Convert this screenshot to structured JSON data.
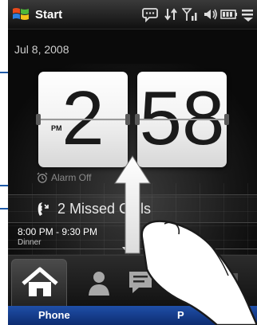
{
  "titlebar": {
    "title": "Start",
    "icons": [
      "windows-flag-icon",
      "chat-bubble-icon",
      "sync-arrows-icon",
      "signal-icon",
      "speaker-icon",
      "battery-icon",
      "menu-icon"
    ]
  },
  "home": {
    "date": "Jul 8, 2008",
    "clock": {
      "hour": "2",
      "minute": "58",
      "ampm": "PM"
    },
    "alarm": "Alarm Off",
    "missed_calls": "2 Missed Calls",
    "appointment": {
      "time": "8:00 PM - 9:30 PM",
      "title": "Dinner"
    }
  },
  "tabs": [
    {
      "name": "home",
      "icon": "home-icon",
      "active": true
    },
    {
      "name": "people",
      "icon": "person-icon",
      "active": false
    },
    {
      "name": "messages",
      "icon": "message-icon",
      "active": false
    },
    {
      "name": "mail",
      "icon": "mail-icon",
      "active": false
    },
    {
      "name": "more",
      "icon": "more-icon",
      "active": false
    }
  ],
  "softkeys": {
    "left": "Phone",
    "right": "P"
  },
  "colors": {
    "softkey_bar": "#1a4399",
    "callout": "#1e5aa8"
  }
}
